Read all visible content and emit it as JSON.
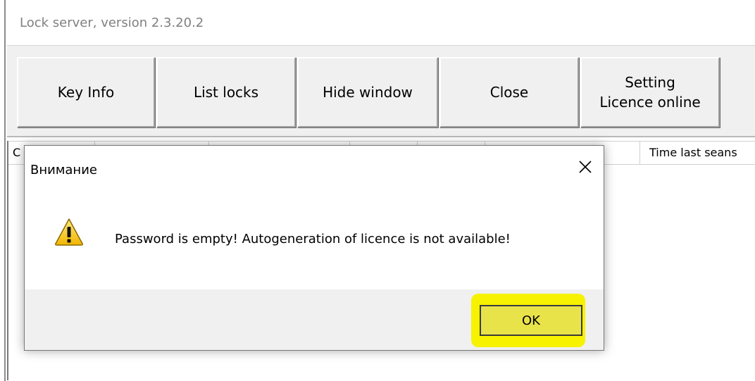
{
  "window": {
    "title": "Lock server, version 2.3.20.2"
  },
  "toolbar": {
    "buttons": [
      {
        "label": "Key Info"
      },
      {
        "label": "List locks"
      },
      {
        "label": "Hide window"
      },
      {
        "label": "Close"
      },
      {
        "label_line1": "Setting",
        "label_line2": "Licence online"
      }
    ]
  },
  "list": {
    "columns": [
      {
        "label": "C"
      },
      {
        "label": "Time last seans"
      }
    ]
  },
  "dialog": {
    "title": "Внимание",
    "message": "Password is empty! Autogeneration of licence is not available!",
    "ok_label": "OK",
    "icon": "warning-icon",
    "close_icon": "close-icon",
    "highlight_color": "#f6f200"
  }
}
